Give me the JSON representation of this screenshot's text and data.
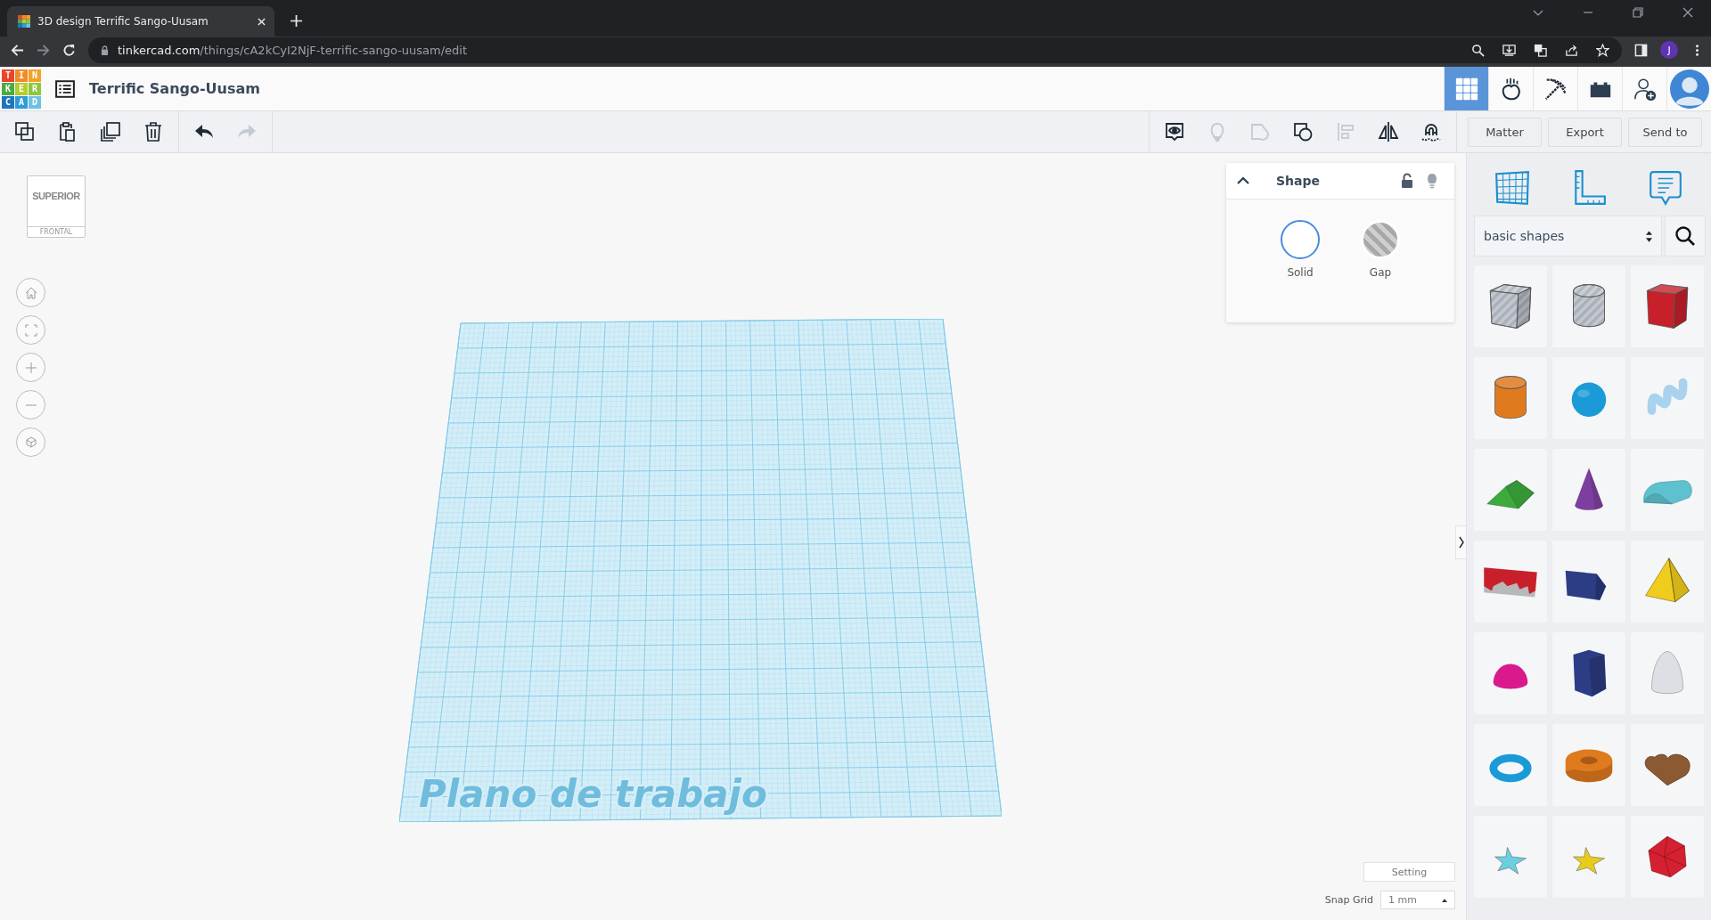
{
  "browser": {
    "tab_title": "3D design Terrific Sango-Uusam",
    "url_host": "tinkercad.com",
    "url_path": "/things/cA2kCyI2NjF-terrific-sango-uusam/edit",
    "profile_initial": "J"
  },
  "app": {
    "logo": [
      "T",
      "I",
      "N",
      "K",
      "E",
      "R",
      "C",
      "A",
      "D"
    ],
    "title": "Terrific Sango-Uusam",
    "nav": [
      {
        "kind": "designs",
        "selected": true
      },
      {
        "kind": "sim",
        "selected": false
      },
      {
        "kind": "pickaxe",
        "selected": false
      },
      {
        "kind": "brick",
        "selected": false
      },
      {
        "kind": "add_user",
        "selected": false
      },
      {
        "kind": "avatar",
        "selected": false
      }
    ]
  },
  "toolbar": {
    "edit_tools": [
      {
        "kind": "copy",
        "disabled": false
      },
      {
        "kind": "paste",
        "disabled": false
      },
      {
        "kind": "duplicate",
        "disabled": false
      },
      {
        "kind": "delete",
        "disabled": false
      }
    ],
    "history_tools": [
      {
        "kind": "undo",
        "disabled": false
      },
      {
        "kind": "redo",
        "disabled": true
      }
    ],
    "view_tools": [
      {
        "kind": "notes",
        "disabled": false
      },
      {
        "kind": "light",
        "disabled": true
      },
      {
        "kind": "group",
        "disabled": true
      },
      {
        "kind": "ungroup",
        "disabled": false
      },
      {
        "kind": "align",
        "disabled": true
      },
      {
        "kind": "mirror",
        "disabled": false
      },
      {
        "kind": "magnet",
        "disabled": false
      }
    ],
    "buttons": [
      "Matter",
      "Export",
      "Send to"
    ]
  },
  "view_cube": {
    "top": "SUPERIOR",
    "front": "FRONTAL"
  },
  "view_controls": [
    {
      "kind": "home"
    },
    {
      "kind": "fit"
    },
    {
      "kind": "zoom_in"
    },
    {
      "kind": "zoom_out"
    },
    {
      "kind": "ortho"
    }
  ],
  "shape_panel": {
    "title": "Shape",
    "expanded": true,
    "locked": false,
    "options": [
      {
        "kind": "solid",
        "label": "Solid",
        "selected": true
      },
      {
        "kind": "hole",
        "label": "Gap",
        "selected": false
      }
    ]
  },
  "workplane": {
    "label": "Plano de trabajo"
  },
  "library": {
    "tools": [
      {
        "kind": "workplane",
        "selected": false
      },
      {
        "kind": "ruler",
        "selected": false
      },
      {
        "kind": "notes",
        "selected": false
      }
    ],
    "category": "basic shapes",
    "shapes": [
      {
        "kind": "box_hole",
        "color": "#c3c8d2"
      },
      {
        "kind": "cylinder_hole",
        "color": "#c3c8d2"
      },
      {
        "kind": "box",
        "color": "#c8202a"
      },
      {
        "kind": "cylinder",
        "color": "#e07a1f"
      },
      {
        "kind": "sphere",
        "color": "#1a9bd7"
      },
      {
        "kind": "scribble",
        "color": "#a9d2ee"
      },
      {
        "kind": "roof",
        "color": "#3cab3c"
      },
      {
        "kind": "cone",
        "color": "#7d3f9e"
      },
      {
        "kind": "round_roof",
        "color": "#5fc0cf"
      },
      {
        "kind": "text",
        "color": "#c8202a"
      },
      {
        "kind": "wedge",
        "color": "#2c3d86"
      },
      {
        "kind": "pyramid",
        "color": "#f0cc1c"
      },
      {
        "kind": "half_sphere",
        "color": "#d91a8c"
      },
      {
        "kind": "polygon",
        "color": "#2c3d86"
      },
      {
        "kind": "paraboloid",
        "color": "#dcdfe3"
      },
      {
        "kind": "torus",
        "color": "#1a9bd7"
      },
      {
        "kind": "tube",
        "color": "#e07a1f"
      },
      {
        "kind": "heart",
        "color": "#8c5a32"
      },
      {
        "kind": "star",
        "color": "#6ccfe0"
      },
      {
        "kind": "star",
        "color": "#e8cc1c"
      },
      {
        "kind": "icosahedron",
        "color": "#d42030"
      }
    ]
  },
  "settings": {
    "button": "Setting",
    "snap_label": "Snap Grid",
    "snap_value": "1 mm"
  }
}
